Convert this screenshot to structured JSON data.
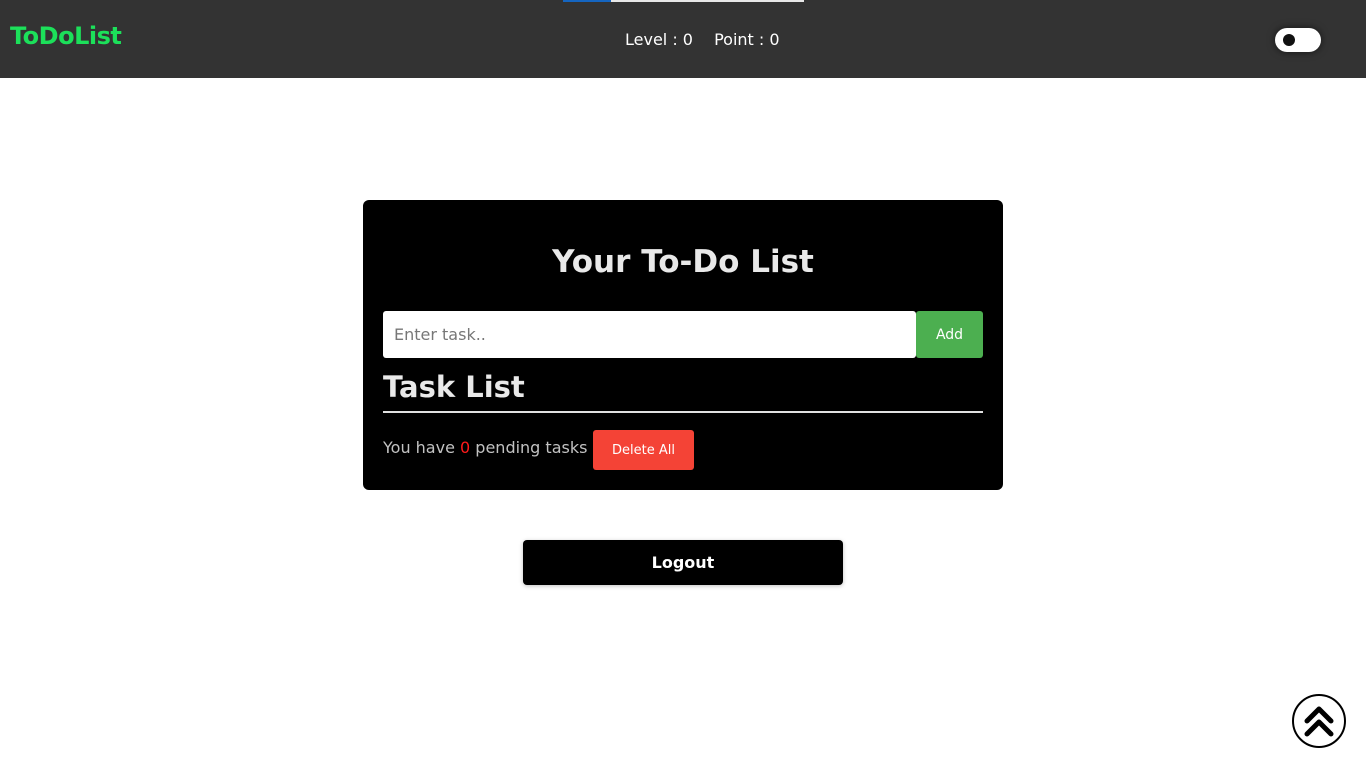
{
  "navbar": {
    "brand": "ToDoList",
    "brand_color": "#1ce05a",
    "background_color": "#333333",
    "level_text": "Level : 0",
    "point_text": "Point : 0",
    "progress_fraction": 0.2,
    "progress_color": "#1565c0",
    "theme_toggle_icon": "toggle-switch-icon"
  },
  "card": {
    "title": "Your To-Do List",
    "input_placeholder": "Enter task..",
    "input_value": "",
    "add_label": "Add",
    "add_color": "#4caf50",
    "task_list_heading": "Task List",
    "pending_prefix": "You have",
    "pending_count": "0",
    "pending_suffix": "pending tasks",
    "delete_all_label": "Delete All",
    "delete_color": "#f44336"
  },
  "logout_label": "Logout",
  "scroll_top_icon": "double-chevron-up-icon"
}
